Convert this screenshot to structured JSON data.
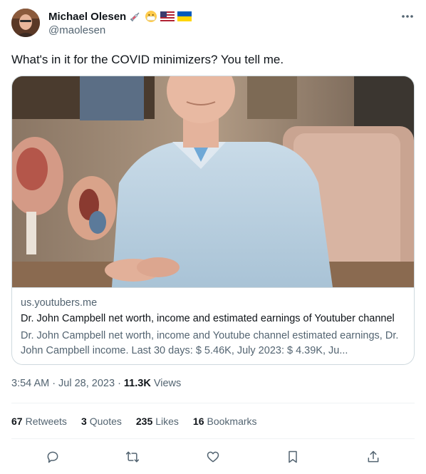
{
  "author": {
    "display_name": "Michael Olesen",
    "handle": "@maolesen",
    "badge_icons": [
      "syringe-icon",
      "mask-face-emoji-icon",
      "us-flag-icon",
      "ukraine-flag-icon"
    ]
  },
  "tweet": {
    "text": "What's in it for the COVID minimizers? You tell me."
  },
  "link_card": {
    "domain": "us.youtubers.me",
    "title": "Dr. John Campbell net worth, income and estimated earnings of Youtuber channel",
    "description": "Dr. John Campbell net worth, income and Youtube channel estimated earnings, Dr. John Campbell income. Last 30 days: $ 5.46K, July 2023: $ 4.39K, Ju..."
  },
  "meta": {
    "time": "3:54 AM",
    "separator": "·",
    "date": "Jul 28, 2023",
    "separator2": "·",
    "views_count": "11.3K",
    "views_label": "Views"
  },
  "stats": {
    "retweets_count": "67",
    "retweets_label": "Retweets",
    "quotes_count": "3",
    "quotes_label": "Quotes",
    "likes_count": "235",
    "likes_label": "Likes",
    "bookmarks_count": "16",
    "bookmarks_label": "Bookmarks"
  },
  "colors": {
    "text_primary": "#0f1419",
    "text_secondary": "#536471",
    "border": "#cfd9de",
    "divider": "#eff3f4"
  }
}
